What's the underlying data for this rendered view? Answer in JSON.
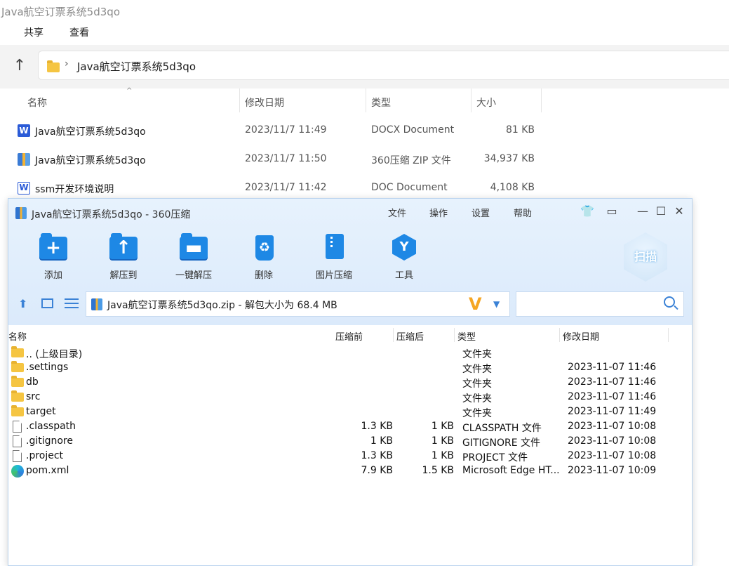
{
  "explorer": {
    "title": "Java航空订票系统5d3qo",
    "ribbon": [
      "共享",
      "查看"
    ],
    "path_item": "Java航空订票系统5d3qo",
    "columns": {
      "name": "名称",
      "modified": "修改日期",
      "type": "类型",
      "size": "大小"
    },
    "files": [
      {
        "icon": "word-docx-icon",
        "name": "Java航空订票系统5d3qo",
        "modified": "2023/11/7 11:49",
        "type": "DOCX Document",
        "size": "81 KB"
      },
      {
        "icon": "zip-icon",
        "name": "Java航空订票系统5d3qo",
        "modified": "2023/11/7 11:50",
        "type": "360压缩 ZIP 文件",
        "size": "34,937 KB"
      },
      {
        "icon": "word-doc-icon",
        "name": "ssm开发环境说明",
        "modified": "2023/11/7 11:42",
        "type": "DOC Document",
        "size": "4,108 KB"
      }
    ]
  },
  "zipwin": {
    "title": "Java航空订票系统5d3qo - 360压缩",
    "menu": [
      "文件",
      "操作",
      "设置",
      "帮助"
    ],
    "tools": {
      "add": "添加",
      "extract_to": "解压到",
      "one_click": "一键解压",
      "delete": "删除",
      "img_compress": "图片压缩",
      "tools": "工具"
    },
    "scan_label": "扫描",
    "path_text": "Java航空订票系统5d3qo.zip - 解包大小为 68.4 MB",
    "columns": {
      "name": "名称",
      "packed_before": "压缩前",
      "packed_after": "压缩后",
      "type": "类型",
      "modified": "修改日期"
    },
    "files": [
      {
        "kind": "folder",
        "name": ".. (上级目录)",
        "before": "",
        "after": "",
        "type": "文件夹",
        "date": ""
      },
      {
        "kind": "folder",
        "name": ".settings",
        "before": "",
        "after": "",
        "type": "文件夹",
        "date": "2023-11-07 11:46"
      },
      {
        "kind": "folder",
        "name": "db",
        "before": "",
        "after": "",
        "type": "文件夹",
        "date": "2023-11-07 11:46"
      },
      {
        "kind": "folder",
        "name": "src",
        "before": "",
        "after": "",
        "type": "文件夹",
        "date": "2023-11-07 11:46"
      },
      {
        "kind": "folder",
        "name": "target",
        "before": "",
        "after": "",
        "type": "文件夹",
        "date": "2023-11-07 11:49"
      },
      {
        "kind": "file",
        "name": ".classpath",
        "before": "1.3 KB",
        "after": "1 KB",
        "type": "CLASSPATH 文件",
        "date": "2023-11-07 10:08"
      },
      {
        "kind": "file",
        "name": ".gitignore",
        "before": "1 KB",
        "after": "1 KB",
        "type": "GITIGNORE 文件",
        "date": "2023-11-07 10:08"
      },
      {
        "kind": "file",
        "name": ".project",
        "before": "1.3 KB",
        "after": "1 KB",
        "type": "PROJECT 文件",
        "date": "2023-11-07 10:08"
      },
      {
        "kind": "edge",
        "name": "pom.xml",
        "before": "7.9 KB",
        "after": "1.5 KB",
        "type": "Microsoft Edge HT...",
        "date": "2023-11-07 10:09"
      }
    ]
  }
}
